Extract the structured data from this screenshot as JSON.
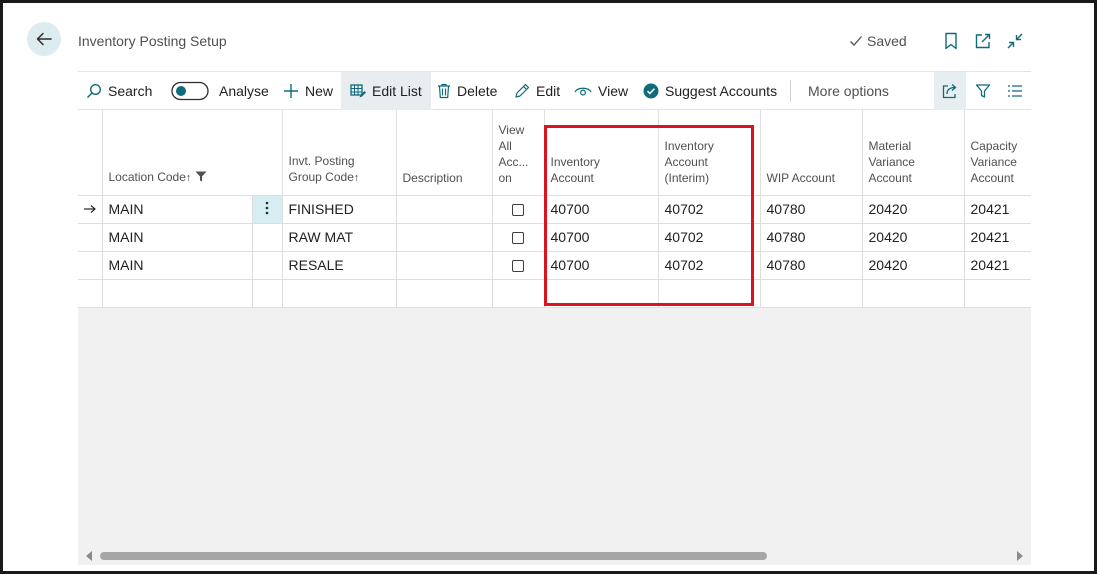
{
  "header": {
    "title": "Inventory Posting Setup",
    "saved_label": "Saved"
  },
  "actions": {
    "search": "Search",
    "analyse": "Analyse",
    "new": "New",
    "edit_list": "Edit List",
    "delete": "Delete",
    "edit": "Edit",
    "view": "View",
    "suggest_accounts": "Suggest Accounts",
    "more_options": "More options"
  },
  "columns": {
    "location_code": "Location Code",
    "invt_posting_group_l1": "Invt. Posting",
    "invt_posting_group_l2": "Group Code",
    "description": "Description",
    "view_all_l1": "View",
    "view_all_l2": "All",
    "view_all_l3": "Acc...",
    "view_all_l4": "on",
    "inventory_account_l1": "Inventory",
    "inventory_account_l2": "Account",
    "inventory_interim_l1": "Inventory",
    "inventory_interim_l2": "Account",
    "inventory_interim_l3": "(Interim)",
    "wip_account": "WIP Account",
    "material_variance_l1": "Material",
    "material_variance_l2": "Variance",
    "material_variance_l3": "Account",
    "capacity_variance_l1": "Capacity",
    "capacity_variance_l2": "Variance",
    "capacity_variance_l3": "Account"
  },
  "rows": [
    {
      "location": "MAIN",
      "group": "FINISHED",
      "description": "",
      "view_all": false,
      "inventory": "40700",
      "interim": "40702",
      "wip": "40780",
      "material": "20420",
      "capacity": "20421"
    },
    {
      "location": "MAIN",
      "group": "RAW MAT",
      "description": "",
      "view_all": false,
      "inventory": "40700",
      "interim": "40702",
      "wip": "40780",
      "material": "20420",
      "capacity": "20421"
    },
    {
      "location": "MAIN",
      "group": "RESALE",
      "description": "",
      "view_all": false,
      "inventory": "40700",
      "interim": "40702",
      "wip": "40780",
      "material": "20420",
      "capacity": "20421"
    }
  ],
  "icons": {
    "back": "back-arrow-icon",
    "saved": "checkmark-icon",
    "bookmark": "bookmark-icon",
    "open_new": "open-in-new-window-icon",
    "collapse": "collapse-icon",
    "search": "search-icon",
    "new": "plus-icon",
    "edit_list": "edit-list-icon",
    "delete": "trash-icon",
    "edit": "pencil-icon",
    "view": "eye-icon",
    "suggest": "check-circle-icon",
    "share": "share-icon",
    "filter": "filter-icon",
    "list": "list-view-icon"
  },
  "colors": {
    "accent": "#0f6b7a",
    "highlight_box": "#d9141c",
    "selected_cell": "#d6eef2"
  }
}
